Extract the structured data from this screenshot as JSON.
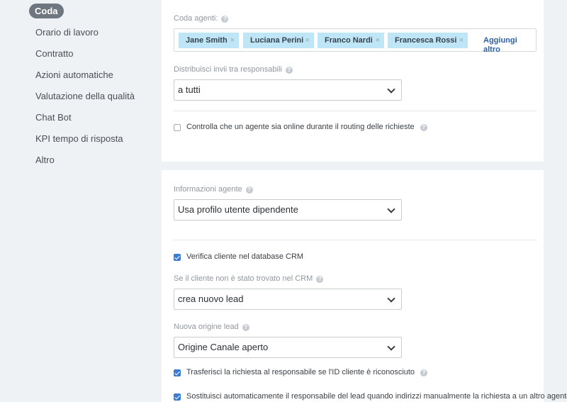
{
  "sidebar": {
    "active": "Coda",
    "items": [
      "Orario di lavoro",
      "Contratto",
      "Azioni automatiche",
      "Valutazione della qualità",
      "Chat Bot",
      "KPI tempo di risposta",
      "Altro"
    ]
  },
  "queue": {
    "label": "Coda agenti:",
    "agents": [
      "Jane Smith",
      "Luciana Perini",
      "Franco Nardi",
      "Francesca Rossi"
    ],
    "add_more": "Aggiungi altro",
    "distribute_label": "Distribuisci invii tra responsabili",
    "distribute_value": "a tutti",
    "online_check_label": "Controlla che un agente sia online durante il routing delle richieste",
    "online_check_checked": false
  },
  "agent_info": {
    "label": "Informazioni agente",
    "value": "Usa profilo utente dipendente",
    "crm_check_label": "Verifica cliente nel database CRM",
    "crm_check_checked": true,
    "not_found_label": "Se il cliente non è stato trovato nel CRM",
    "not_found_value": "crea nuovo lead",
    "lead_source_label": "Nuova origine lead",
    "lead_source_value": "Origine Canale aperto",
    "transfer_label": "Trasferisci la richiesta al responsabile se l'ID cliente è riconosciuto",
    "transfer_checked": true,
    "replace_label": "Sostituisci automaticamente il responsabile del lead quando indirizzi manualmente la richiesta a un altro agente",
    "replace_checked": true
  },
  "help_glyph": "?",
  "remove_glyph": "×",
  "colors": {
    "accent": "#3a7bd5",
    "tag_bg": "#bfe6f7",
    "active_pill": "#6e7680",
    "link": "#2d5fa5"
  }
}
